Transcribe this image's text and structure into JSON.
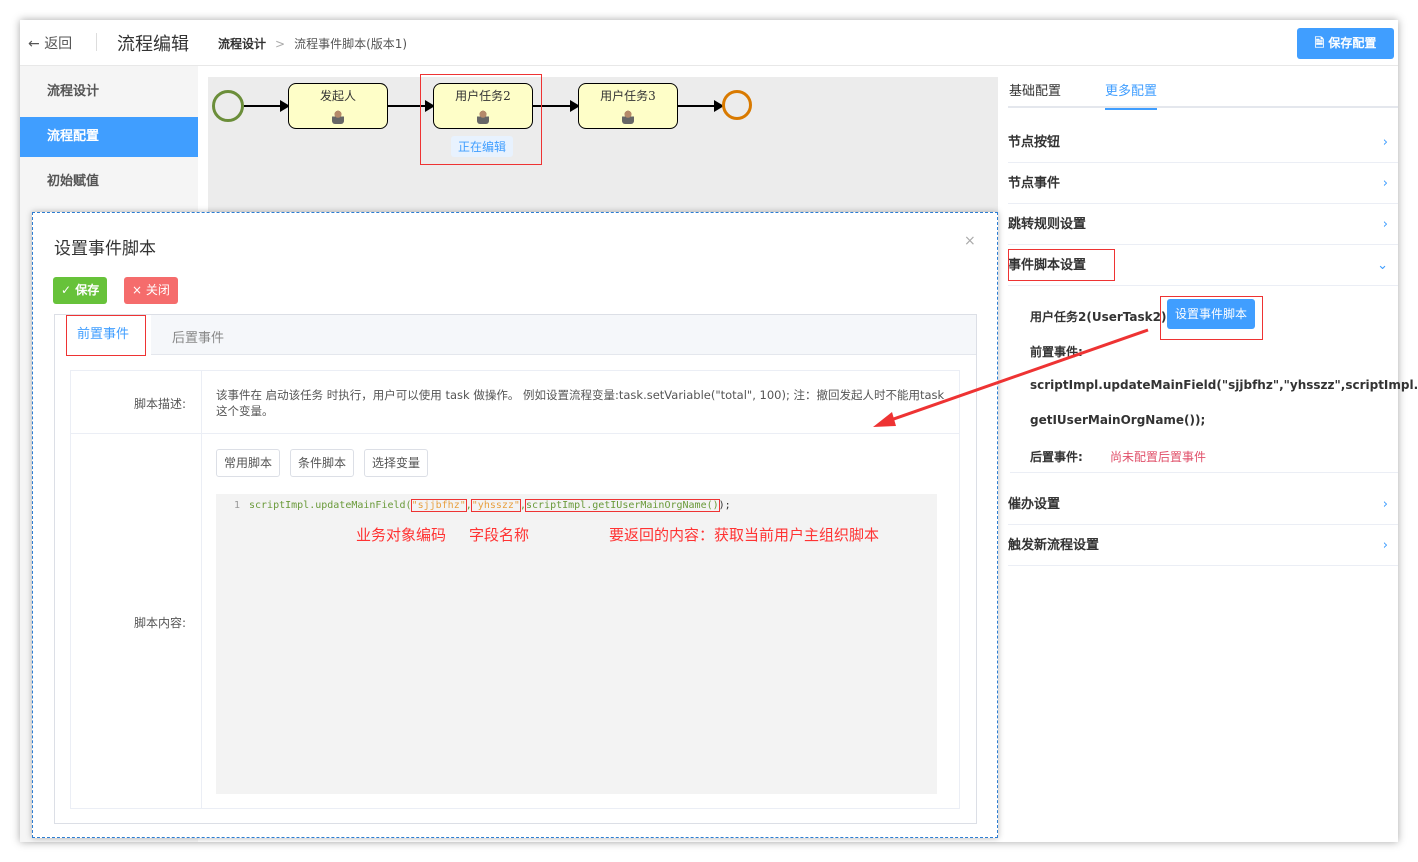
{
  "header": {
    "back_label": "返回",
    "title": "流程编辑",
    "breadcrumb": [
      "流程设计",
      "流程事件脚本(版本1)"
    ],
    "save_config_label": "保存配置"
  },
  "sidebar": {
    "items": [
      {
        "label": "流程设计"
      },
      {
        "label": "流程配置"
      },
      {
        "label": "初始赋值"
      }
    ]
  },
  "flow": {
    "nodes": [
      "发起人",
      "用户任务2",
      "用户任务3"
    ],
    "editing_badge": "正在编辑"
  },
  "right_panel": {
    "tabs": [
      "基础配置",
      "更多配置"
    ],
    "rows": [
      "节点按钮",
      "节点事件",
      "跳转规则设置",
      "事件脚本设置",
      "催办设置",
      "触发新流程设置"
    ],
    "task_name": "用户任务2(UserTask2)",
    "set_script_button": "设置事件脚本",
    "pre_event_label": "前置事件:",
    "pre_event_line1": "scriptImpl.updateMainField(\"sjjbfhz\",\"yhsszz\",scriptImpl.",
    "pre_event_line2": "getIUserMainOrgName());",
    "post_event_label": "后置事件:",
    "post_event_value": "尚未配置后置事件"
  },
  "modal": {
    "title": "设置事件脚本",
    "close": "×",
    "save_label": "保存",
    "close_label": "关闭",
    "tabs": [
      "前置事件",
      "后置事件"
    ],
    "desc_label": "脚本描述:",
    "desc_text": "该事件在 启动该任务 时执行，用户可以使用 task 做操作。 例如设置流程变量:task.setVariable(\"total\", 100); 注：撤回发起人时不能用task这个变量。",
    "content_label": "脚本内容:",
    "script_buttons": [
      "常用脚本",
      "条件脚本",
      "选择变量"
    ],
    "code": {
      "line_no": "1",
      "prefix": "scriptImpl.updateMainField(",
      "arg1": "\"sjjbfhz\"",
      "arg2": "\"yhsszz\"",
      "arg3": "scriptImpl.getIUserMainOrgName()",
      "suffix": ");"
    },
    "annotations": [
      "业务对象编码",
      "字段名称",
      "要返回的内容：获取当前用户主组织脚本"
    ]
  }
}
